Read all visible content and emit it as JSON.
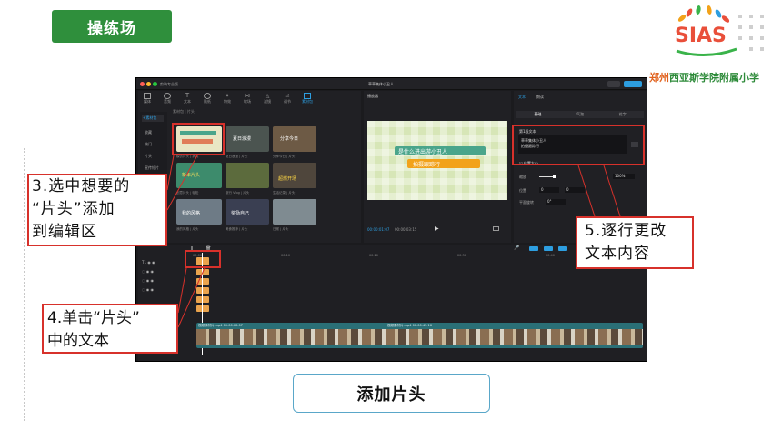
{
  "header": {
    "badge": "操练场"
  },
  "logo": {
    "text": "SIAS"
  },
  "school": {
    "name_part1": "郑州",
    "name_part2": "西亚斯学院附属小学"
  },
  "app": {
    "window_title": "剪映专业版",
    "project_title": "草草集体小丑人",
    "top_tabs": [
      "媒体",
      "音频",
      "文本",
      "贴纸",
      "特效",
      "转场",
      "滤镜",
      "调节",
      "素材包"
    ],
    "side_items": [
      "+素材包",
      "收藏",
      "热门",
      "片头",
      "宣传短片"
    ],
    "library_header": "素材包 | 片头",
    "thumbnails": [
      {
        "cap": "模仿片头 | 搞笑",
        "text": ""
      },
      {
        "cap": "夏日浪漫 | 片头",
        "text": "夏日浪漫"
      },
      {
        "cap": "分享今日 | 片头",
        "text": "分享今日"
      },
      {
        "cap": "创意片头 | 轻松",
        "text": "新年片头"
      },
      {
        "cap": "旅行 Vlog | 片头",
        "text": ""
      },
      {
        "cap": "生活记录 | 片头",
        "text": "超燃开场"
      },
      {
        "cap": "我的风格 | 片头",
        "text": "我的风格"
      },
      {
        "cap": "美食推荐 | 片头",
        "text": "奖励自己"
      },
      {
        "cap": "日常 | 片头",
        "text": ""
      }
    ],
    "player": {
      "title": "播放器",
      "time_current": "00:00:01:07",
      "time_total": "00:00:03:15",
      "preview_line1": "是什么进出游小丑人",
      "preview_line2": "拍摄跟踪行"
    },
    "inspector": {
      "tabs": [
        "文本",
        "朗读"
      ],
      "subtabs": [
        "基础",
        "气泡",
        "花字"
      ],
      "section": "第1段文本",
      "text_value_line1": "草草集体小丑人",
      "text_value_line2": "拍摄跟踪行",
      "size_label": "缩放",
      "size_value": "100%",
      "position_label": "位置",
      "pos_x": "0",
      "pos_y": "0",
      "rotation_label": "平面旋转",
      "rotation_value": "0°",
      "checkbox_label": "位置大小"
    },
    "timeline": {
      "ruler": [
        "00:00",
        "00:10",
        "00:20",
        "00:30",
        "00:40",
        "00:50"
      ],
      "clip1_label": "视频素材片.mp4   00:00:00:07",
      "clip2_label": "视频素材片.mp4   00:00:45:16"
    }
  },
  "callouts": {
    "c3_line1": "3.选中想要的",
    "c3_line2": "“片头”添加",
    "c3_line3": "到编辑区",
    "c4_line1": "4.单击“片头”",
    "c4_line2": "中的文本",
    "c5_line1": "5.逐行更改",
    "c5_line2": "文本内容"
  },
  "bottom_label": "添加片头",
  "colors": {
    "badge": "#2f8f3c",
    "callout_border": "#d7312b",
    "label_border": "#5aa7c9",
    "accent": "#2d9ee0"
  }
}
